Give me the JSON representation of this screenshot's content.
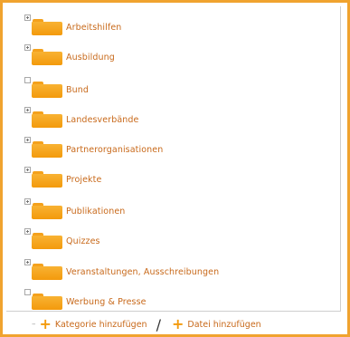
{
  "categories": [
    {
      "label": "Arbeitshilfen",
      "expander": "plus"
    },
    {
      "label": "Ausbildung",
      "expander": "plus"
    },
    {
      "label": "Bund",
      "expander": "empty"
    },
    {
      "label": "Landesverbände",
      "expander": "plus"
    },
    {
      "label": "Partnerorganisationen",
      "expander": "plus"
    },
    {
      "label": "Projekte",
      "expander": "plus"
    },
    {
      "label": "Publikationen",
      "expander": "plus"
    },
    {
      "label": "Quizzes",
      "expander": "plus"
    },
    {
      "label": "Veranstaltungen, Ausschreibungen",
      "expander": "plus"
    },
    {
      "label": "Werbung & Presse",
      "expander": "empty"
    }
  ],
  "footer": {
    "add_category": "Kategorie hinzufügen",
    "add_file": "Datei hinzufügen",
    "separator": "/"
  },
  "colors": {
    "border": "#f0a32f",
    "folder": "#f39a0c",
    "label": "#c8691a"
  },
  "icons": {
    "folder": "folder-icon",
    "expander": "expander-icon",
    "add": "plus-icon"
  }
}
